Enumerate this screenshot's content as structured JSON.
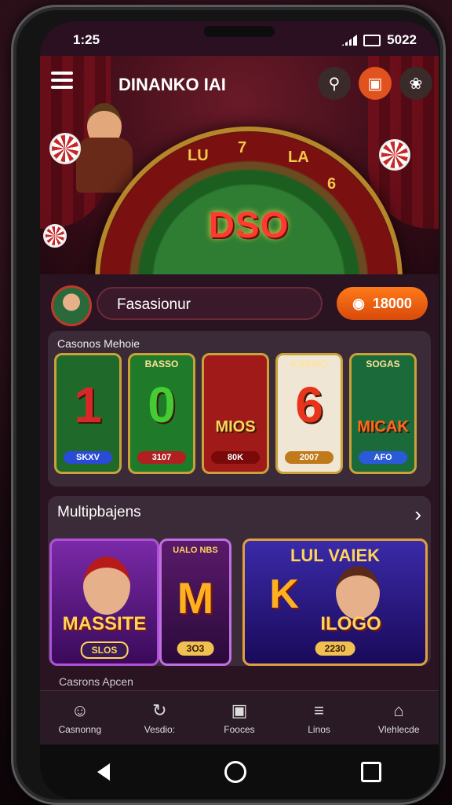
{
  "status": {
    "time": "1:25",
    "right": "5022"
  },
  "app": {
    "title": "DINANKO IAI",
    "banner_logo": "DSO"
  },
  "header_icons": [
    "microphone-icon",
    "gift-icon",
    "profile-icon"
  ],
  "profile": {
    "name": "Fasasionur",
    "coins": "18000"
  },
  "section1": {
    "title": "Casonos Mehoie",
    "cards": [
      {
        "top": "",
        "big": "1",
        "pill": "SKXV",
        "bg": "#1f6a2a",
        "color": "#d62828",
        "pillbg": "#2a4ad8"
      },
      {
        "top": "BASSO",
        "big": "0",
        "pill": "3107",
        "bg": "#1f7a2a",
        "color": "#44cc33",
        "pillbg": "#b02020"
      },
      {
        "top": "",
        "big": "MIOS",
        "pill": "80K",
        "bg": "#a01a1a",
        "color": "#ffd45a",
        "pillbg": "#7a0a0a"
      },
      {
        "top": "KASINO",
        "big": "6",
        "pill": "2007",
        "bg": "#f0e6d6",
        "color": "#e8341a",
        "pillbg": "#c07a1a"
      },
      {
        "top": "SOGAS",
        "big": "MICAK",
        "pill": "AFO",
        "bg": "#1a6a3a",
        "color": "#ff6a1a",
        "pillbg": "#2a5ad8"
      }
    ]
  },
  "section2": {
    "title": "Multipbajens",
    "games": [
      {
        "title": "MASSITE",
        "pill": "SLOS"
      },
      {
        "top": "UALO NBS",
        "title": "M",
        "pill": "3O3"
      },
      {
        "top": "LUL VAIEK",
        "title": "K",
        "sub": "ILOGO",
        "pill": "2230"
      }
    ]
  },
  "section3": {
    "title": "Casrons Apcen"
  },
  "bottom_nav": [
    {
      "label": "Casnonng",
      "icon": "avatar-icon"
    },
    {
      "label": "Vesdio:",
      "icon": "refresh-icon"
    },
    {
      "label": "Fooces",
      "icon": "bag-icon"
    },
    {
      "label": "Linos",
      "icon": "cards-icon"
    },
    {
      "label": "Vlehlecde",
      "icon": "trophy-icon"
    }
  ]
}
